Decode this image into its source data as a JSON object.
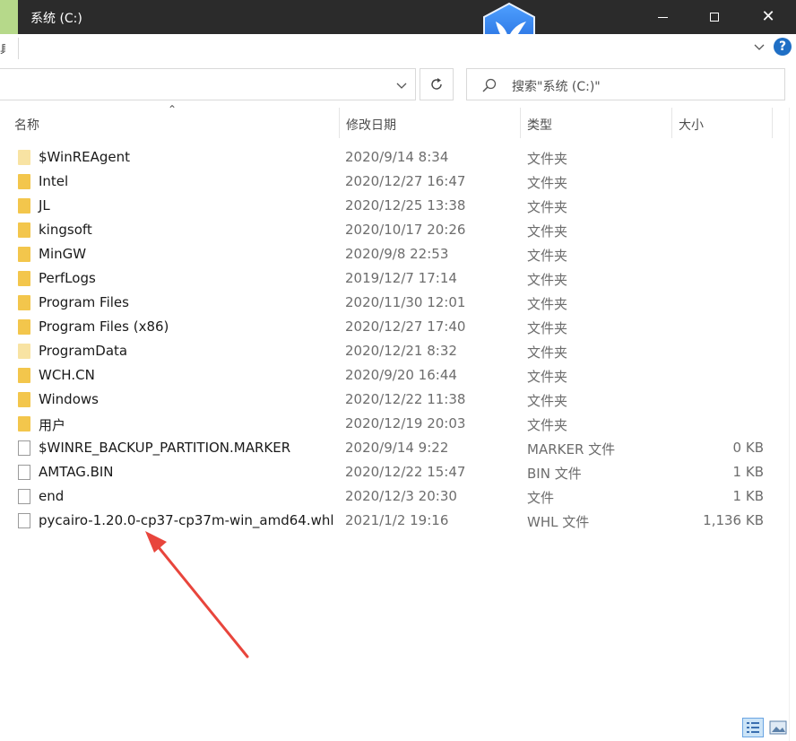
{
  "window": {
    "title": "系统 (C:)",
    "ribbon_left_fragment": "具"
  },
  "search": {
    "placeholder": "搜索\"系统 (C:)\""
  },
  "columns": {
    "name": "名称",
    "date": "修改日期",
    "type": "类型",
    "size": "大小"
  },
  "files": [
    {
      "name": "$WinREAgent",
      "date": "2020/9/14 8:34",
      "type": "文件夹",
      "size": "",
      "kind": "folder-light"
    },
    {
      "name": "Intel",
      "date": "2020/12/27 16:47",
      "type": "文件夹",
      "size": "",
      "kind": "folder"
    },
    {
      "name": "JL",
      "date": "2020/12/25 13:38",
      "type": "文件夹",
      "size": "",
      "kind": "folder"
    },
    {
      "name": "kingsoft",
      "date": "2020/10/17 20:26",
      "type": "文件夹",
      "size": "",
      "kind": "folder"
    },
    {
      "name": "MinGW",
      "date": "2020/9/8 22:53",
      "type": "文件夹",
      "size": "",
      "kind": "folder"
    },
    {
      "name": "PerfLogs",
      "date": "2019/12/7 17:14",
      "type": "文件夹",
      "size": "",
      "kind": "folder"
    },
    {
      "name": "Program Files",
      "date": "2020/11/30 12:01",
      "type": "文件夹",
      "size": "",
      "kind": "folder"
    },
    {
      "name": "Program Files (x86)",
      "date": "2020/12/27 17:40",
      "type": "文件夹",
      "size": "",
      "kind": "folder"
    },
    {
      "name": "ProgramData",
      "date": "2020/12/21 8:32",
      "type": "文件夹",
      "size": "",
      "kind": "folder-light"
    },
    {
      "name": "WCH.CN",
      "date": "2020/9/20 16:44",
      "type": "文件夹",
      "size": "",
      "kind": "folder"
    },
    {
      "name": "Windows",
      "date": "2020/12/22 11:38",
      "type": "文件夹",
      "size": "",
      "kind": "folder"
    },
    {
      "name": "用户",
      "date": "2020/12/19 20:03",
      "type": "文件夹",
      "size": "",
      "kind": "folder"
    },
    {
      "name": "$WINRE_BACKUP_PARTITION.MARKER",
      "date": "2020/9/14 9:22",
      "type": "MARKER 文件",
      "size": "0 KB",
      "kind": "file"
    },
    {
      "name": "AMTAG.BIN",
      "date": "2020/12/22 15:47",
      "type": "BIN 文件",
      "size": "1 KB",
      "kind": "file"
    },
    {
      "name": "end",
      "date": "2020/12/3 20:30",
      "type": "文件",
      "size": "1 KB",
      "kind": "file"
    },
    {
      "name": "pycairo-1.20.0-cp37-cp37m-win_amd64.whl",
      "date": "2021/1/2 19:16",
      "type": "WHL 文件",
      "size": "1,136 KB",
      "kind": "file"
    }
  ],
  "icons": {
    "folder": "folder-icon",
    "file": "file-icon",
    "search": "search-icon",
    "refresh": "refresh-icon",
    "help": "help-icon",
    "logo": "bird-logo-icon"
  },
  "colors": {
    "titlebar": "#2b2b2b",
    "accent": "#1f6fc5",
    "annotation_arrow": "#e8453c",
    "folder": "#f3c64c"
  }
}
